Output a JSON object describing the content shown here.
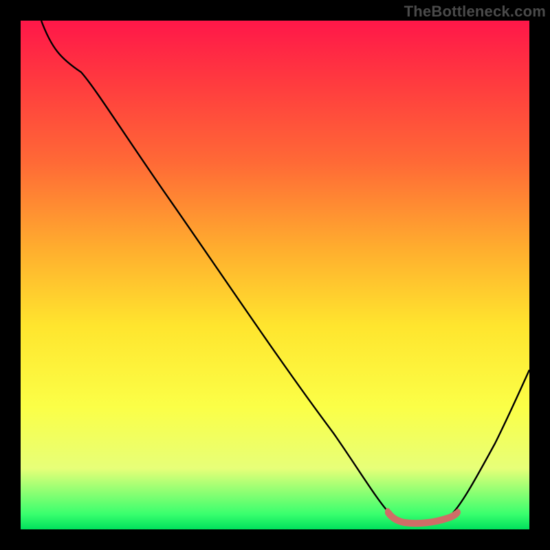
{
  "watermark": "TheBottleneck.com",
  "colors": {
    "curve": "#000000",
    "highlight": "#cf6d67",
    "gradient_top": "#ff1749",
    "gradient_bottom": "#00e05c"
  },
  "chart_data": {
    "type": "line",
    "title": "",
    "xlabel": "",
    "ylabel": "",
    "xlim": [
      0,
      100
    ],
    "ylim": [
      0,
      100
    ],
    "x": [
      4,
      8,
      12,
      20,
      30,
      40,
      50,
      60,
      65,
      70,
      75,
      80,
      85,
      90,
      100
    ],
    "values": [
      100,
      96,
      93,
      85,
      73,
      60,
      47,
      33,
      22,
      10,
      3,
      2,
      4,
      12,
      38
    ],
    "highlight_region_x": [
      72,
      85
    ]
  }
}
